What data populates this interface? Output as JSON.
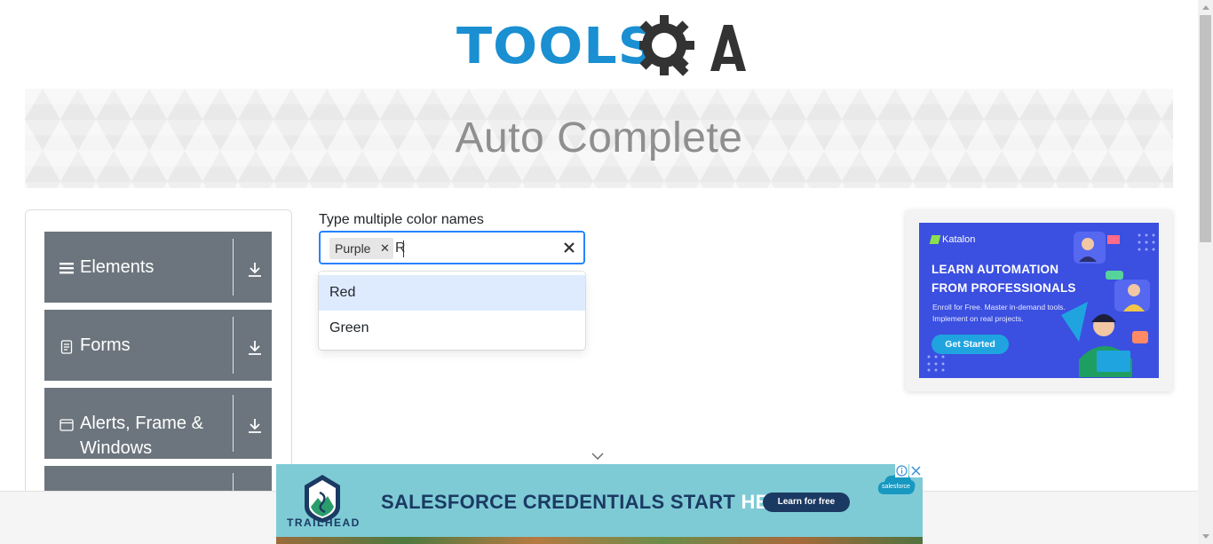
{
  "header": {
    "logo_text": "TOOLS",
    "logo_suffix": "QA",
    "brand_color": "#1a8fd1",
    "accent_color": "#333333"
  },
  "banner": {
    "title": "Auto Complete"
  },
  "sidebar": {
    "groups": [
      {
        "label": "Elements",
        "icon": "hamburger-icon"
      },
      {
        "label": "Forms",
        "icon": "document-icon"
      },
      {
        "label": "Alerts, Frame & Windows",
        "label_line1": "Alerts, Frame &",
        "label_line2": "Windows",
        "icon": "window-icon"
      },
      {
        "label": "",
        "icon": ""
      }
    ],
    "group_color": "#6c757d",
    "expand_icon": "download-arrow-icon"
  },
  "autocomplete": {
    "label": "Type multiple color names",
    "selected_chips": [
      "Purple"
    ],
    "typed_value": "R",
    "focus_color": "#2684ff",
    "options": [
      {
        "label": "Red",
        "focused": true
      },
      {
        "label": "Green",
        "focused": false
      }
    ]
  },
  "side_ad": {
    "brand": "Katalon",
    "headline_line1": "LEARN AUTOMATION",
    "headline_line2": "FROM PROFESSIONALS",
    "subtext": "Enroll for Free. Master in-demand tools. Implement on real projects.",
    "cta": "Get Started",
    "bg_color": "#3b4fe0"
  },
  "bottom_ad": {
    "brand": "TRAILHEAD",
    "headline": "SALESFORCE CREDENTIALS START",
    "headline_highlight": "HERE.",
    "cta": "Learn for free",
    "partner": "salesforce",
    "bg_color": "#7ecbd6"
  }
}
